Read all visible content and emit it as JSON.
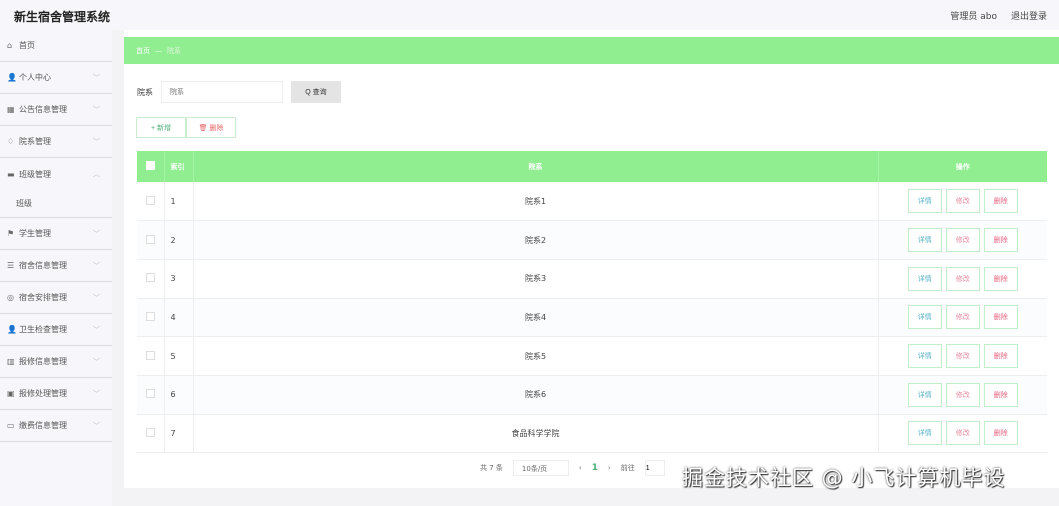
{
  "header": {
    "title": "新生宿舍管理系统",
    "user": "管理员 abo",
    "logout": "退出登录"
  },
  "sidebar": {
    "items": [
      {
        "label": "首页",
        "icon": "home-icon",
        "glyph": "⌂"
      },
      {
        "label": "个人中心",
        "icon": "user-icon",
        "glyph": "👤"
      },
      {
        "label": "公告信息管理",
        "icon": "grid-icon",
        "glyph": "▦"
      },
      {
        "label": "院系管理",
        "icon": "bell-icon",
        "glyph": "♢"
      },
      {
        "label": "班级管理",
        "icon": "chat-icon",
        "glyph": "▬",
        "open": true,
        "sub": "班级"
      },
      {
        "label": "学生管理",
        "icon": "flag-icon",
        "glyph": "⚑"
      },
      {
        "label": "宿舍信息管理",
        "icon": "list-icon",
        "glyph": "☰"
      },
      {
        "label": "宿舍安排管理",
        "icon": "dial-icon",
        "glyph": "◎"
      },
      {
        "label": "卫生检查管理",
        "icon": "user-icon",
        "glyph": "👤"
      },
      {
        "label": "报修信息管理",
        "icon": "bar-chart-icon",
        "glyph": "▥"
      },
      {
        "label": "报修处理管理",
        "icon": "clipboard-icon",
        "glyph": "▣"
      },
      {
        "label": "缴费信息管理",
        "icon": "message-icon",
        "glyph": "▭"
      }
    ]
  },
  "breadcrumb": {
    "home": "首页",
    "sep": "—",
    "current": "院系"
  },
  "search": {
    "label": "院系",
    "placeholder": "院系",
    "button": "Q 查询"
  },
  "actions": {
    "add": "+ 新增",
    "delete": "🗑 删除"
  },
  "table": {
    "headers": [
      "索引",
      "院系",
      "操作"
    ],
    "rows": [
      [
        "1",
        "院系1"
      ],
      [
        "2",
        "院系2"
      ],
      [
        "3",
        "院系3"
      ],
      [
        "4",
        "院系4"
      ],
      [
        "5",
        "院系5"
      ],
      [
        "6",
        "院系6"
      ],
      [
        "7",
        "食品科学学院"
      ]
    ],
    "row_buttons": [
      "详情",
      "修改",
      "删除"
    ]
  },
  "pagination": {
    "total": "共 7 条",
    "page_size": "10条/页",
    "prev": "‹",
    "page": "1",
    "next": "›",
    "goto": "前往",
    "goto_value": "1"
  },
  "watermark": "掘金技术社区 @ 小飞计算机毕设"
}
